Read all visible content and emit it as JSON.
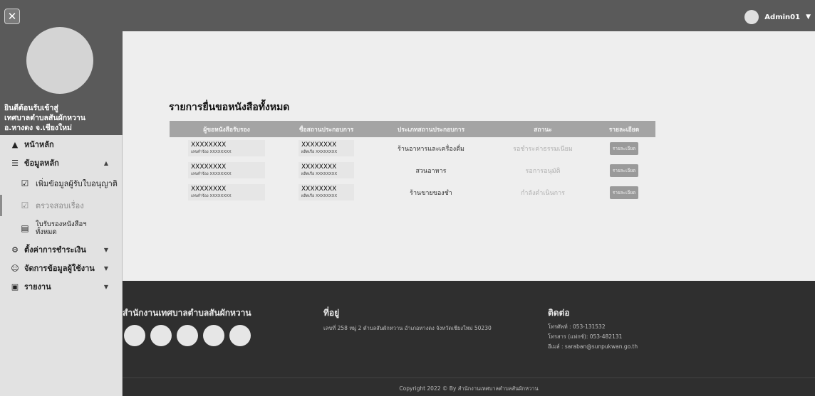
{
  "sidebar": {
    "close_label": "✕",
    "welcome": [
      "ยินดีต้อนรับเข้าสู่",
      "เทศบาลตำบลสันผักหวาน",
      "อ.หางดง จ.เชียงใหม่"
    ],
    "menu": {
      "home": "หน้าหลัก",
      "master": "ข้อมูลหลัก",
      "add_applicant": "เพิ่มข้อมูลผู้รับใบอนุญาติ",
      "verify": "ตรวจสอบเรื่อง",
      "all_receipts_1": "ใบรับรองหนังสือฯ",
      "all_receipts_2": "ทั้งหมด",
      "payment": "ตั้งค่าการชำระเงิน",
      "users": "จัดการข้อมูลผู้ใช้งาน",
      "reports": "รายงาน"
    }
  },
  "topbar": {
    "username": "Admin01"
  },
  "main": {
    "title": "รายการยื่นขอหนังสือทั้งหมด",
    "columns": [
      "ผู้ขอหนังสือรับรอง",
      "ชื่อสถานประกอบการ",
      "ประเภทสถานประกอบการ",
      "สถานะ",
      "รายละเอียด"
    ],
    "rows": [
      {
        "applicant": "XXXXXXXX",
        "applicant_sub_label": "เลขคำร้อง",
        "applicant_sub": "XXXXXXXX",
        "business": "XXXXXXXX",
        "business_sub_label": "ผลิตเรือ",
        "business_sub": "XXXXXXXX",
        "type": "ร้านอาหารและเครื่องดื่ม",
        "status": "รอชำระค่าธรรมเนียม",
        "detail": "รายละเอียด"
      },
      {
        "applicant": "XXXXXXXX",
        "applicant_sub_label": "เลขคำร้อง",
        "applicant_sub": "XXXXXXXX",
        "business": "XXXXXXXX",
        "business_sub_label": "ผลิตเรือ",
        "business_sub": "XXXXXXXX",
        "type": "สวนอาหาร",
        "status": "รอการอนุมัติ",
        "detail": "รายละเอียด"
      },
      {
        "applicant": "XXXXXXXX",
        "applicant_sub_label": "เลขคำร้อง",
        "applicant_sub": "XXXXXXXX",
        "business": "XXXXXXXX",
        "business_sub_label": "ผลิตเรือ",
        "business_sub": "XXXXXXXX",
        "type": "ร้านขายของชำ",
        "status": "กำลังดำเนินการ",
        "detail": "รายละเอียด"
      }
    ]
  },
  "footer": {
    "org": "สำนักงานเทศบาลตำบลสันผักหวาน",
    "address_heading": "ที่อยู่",
    "address": "เลขที่ 258 หมู่ 2 ตำบลสันผักหวาน อำเภอหางดง จังหวัดเชียงใหม่ 50230",
    "contact_heading": "ติดต่อ",
    "phone": "โทรศัพท์ : 053-131532",
    "fax": "โทรสาร (แฟกซ์): 053-482131",
    "email": "อีเมล์ : saraban@sunpukwan.go.th",
    "copyright": "Copyright 2022 © By สำนักงานเทศบาลตำบลสันผักหวาน"
  }
}
